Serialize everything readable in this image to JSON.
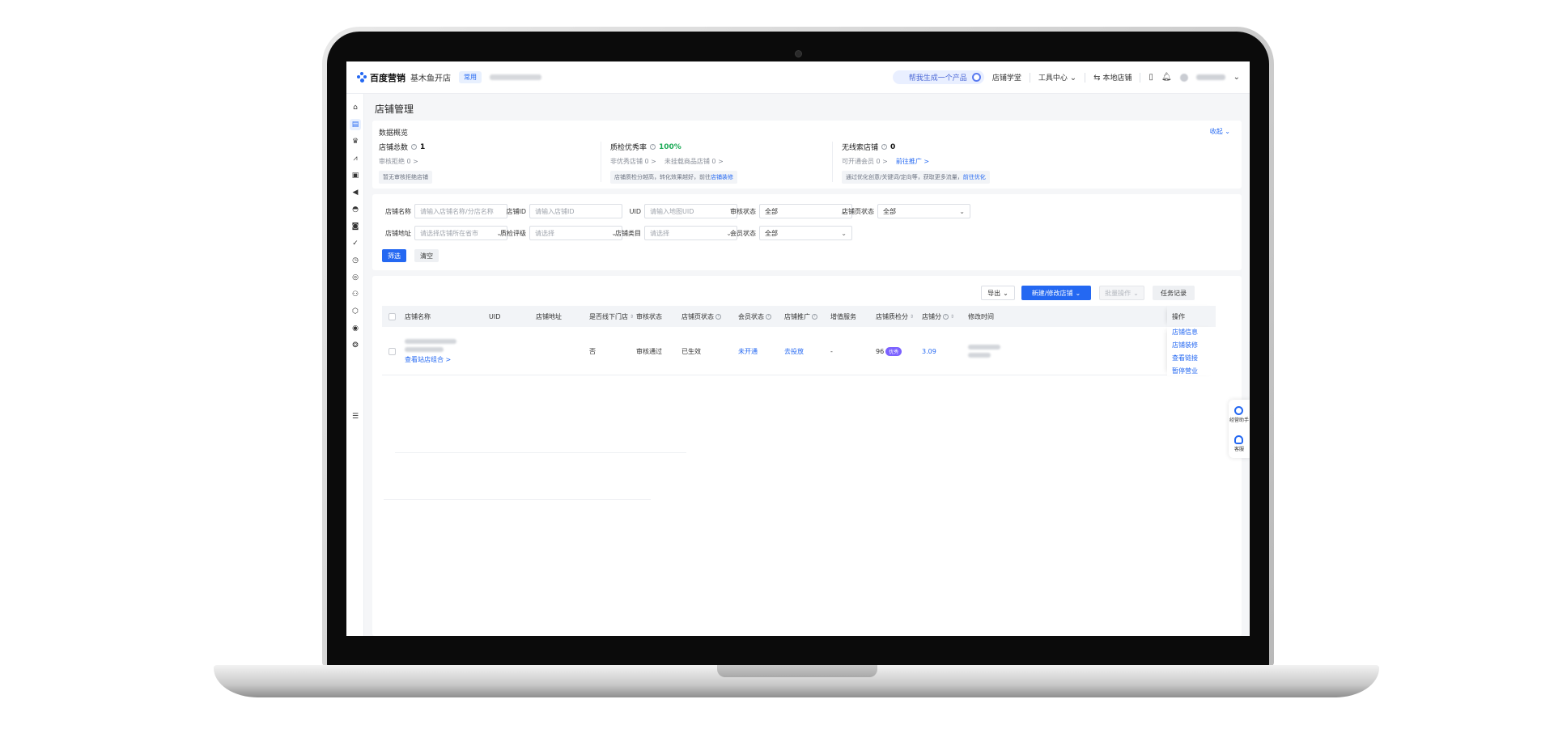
{
  "topbar": {
    "brand": "百度营销",
    "app_name": "基木鱼开店",
    "tag": "常用",
    "ai_prompt": "帮我生成一个产品",
    "links": [
      "店铺学堂",
      "工具中心",
      "本地店铺"
    ]
  },
  "page": {
    "title": "店铺管理"
  },
  "overview": {
    "title": "数据概览",
    "collapse": "收起",
    "columns": [
      {
        "label": "店铺总数",
        "value": "1",
        "sub": [
          "审核拒绝 0 >"
        ],
        "tip": "暂无审核拒绝店铺",
        "tip_link": ""
      },
      {
        "label": "质检优秀率",
        "value": "100%",
        "sub": [
          "非优秀店铺 0 >",
          "未挂载商品店铺 0 >"
        ],
        "tip": "店铺质检分越高，转化效果越好，前往",
        "tip_link": "店铺装修"
      },
      {
        "label": "无线索店铺",
        "value": "0",
        "sub": [
          "可开通会员 0 >",
          "前往推广 >"
        ],
        "tip": "通过优化创意/关键词/定向等，获取更多流量，",
        "tip_link": "前往优化"
      }
    ]
  },
  "filters": {
    "row1": [
      {
        "label": "店铺名称",
        "placeholder": "请输入店铺名称/分店名称",
        "type": "input"
      },
      {
        "label": "店铺ID",
        "placeholder": "请输入店铺ID",
        "type": "input"
      },
      {
        "label": "UID",
        "placeholder": "请输入地图UID",
        "type": "input"
      },
      {
        "label": "审核状态",
        "value": "全部",
        "type": "select"
      },
      {
        "label": "店铺页状态",
        "value": "全部",
        "type": "select"
      }
    ],
    "row2": [
      {
        "label": "店铺地址",
        "placeholder": "请选择店铺所在省市",
        "type": "select"
      },
      {
        "label": "质检评级",
        "placeholder": "请选择",
        "type": "select"
      },
      {
        "label": "店铺类目",
        "placeholder": "请选择",
        "type": "select"
      },
      {
        "label": "会员状态",
        "value": "全部",
        "type": "select"
      }
    ],
    "submit": "筛选",
    "clear": "清空"
  },
  "toolbar": {
    "export": "导出",
    "create": "新建/修改店铺",
    "batch": "批量操作",
    "tasks": "任务记录"
  },
  "table": {
    "columns": [
      "店铺名称",
      "UID",
      "店铺地址",
      "是否线下门店",
      "审核状态",
      "店铺页状态",
      "会员状态",
      "店铺推广",
      "增值服务",
      "店铺质检分",
      "店铺分",
      "修改时间",
      "操作"
    ],
    "row": {
      "view_group": "查看站店组合 >",
      "offline": "否",
      "audit": "审核通过",
      "page_status": "已生效",
      "member": "未开通",
      "promote": "去投放",
      "value_added": "-",
      "quality_score": "96",
      "quality_badge": "优秀",
      "shop_score": "3.09",
      "actions": [
        "店铺信息",
        "店铺装修",
        "查看链接",
        "暂停营业"
      ]
    }
  },
  "helper": {
    "items": [
      "经营助手",
      "客服"
    ]
  }
}
